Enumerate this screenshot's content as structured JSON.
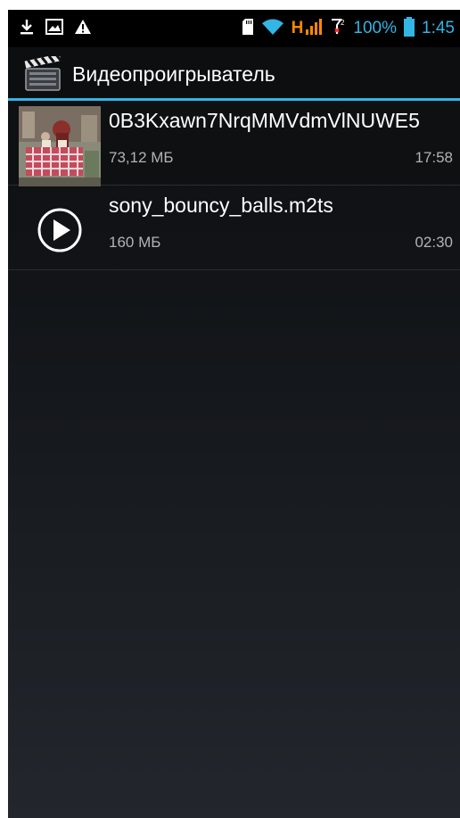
{
  "status_bar": {
    "icons": [
      "download-icon",
      "image-icon",
      "warning-icon",
      "sd-card-icon",
      "wifi-icon",
      "signal-icon",
      "sim-icon",
      "battery-icon"
    ],
    "network_type": "H",
    "battery_percent": "100%",
    "time": "1:45",
    "accent_color": "#33b5e5",
    "network_color": "#ff8800"
  },
  "action_bar": {
    "title": "Видеопроигрыватель",
    "icon": "clapperboard-icon"
  },
  "videos": [
    {
      "name": "0B3Kxawn7NrqMMVdmVlNUWE5",
      "size": "73,12 МБ",
      "duration": "17:58",
      "thumbnail": "video-thumbnail"
    },
    {
      "name": "sony_bouncy_balls.m2ts",
      "size": "160 МБ",
      "duration": "02:30",
      "thumbnail": "play-icon"
    }
  ]
}
